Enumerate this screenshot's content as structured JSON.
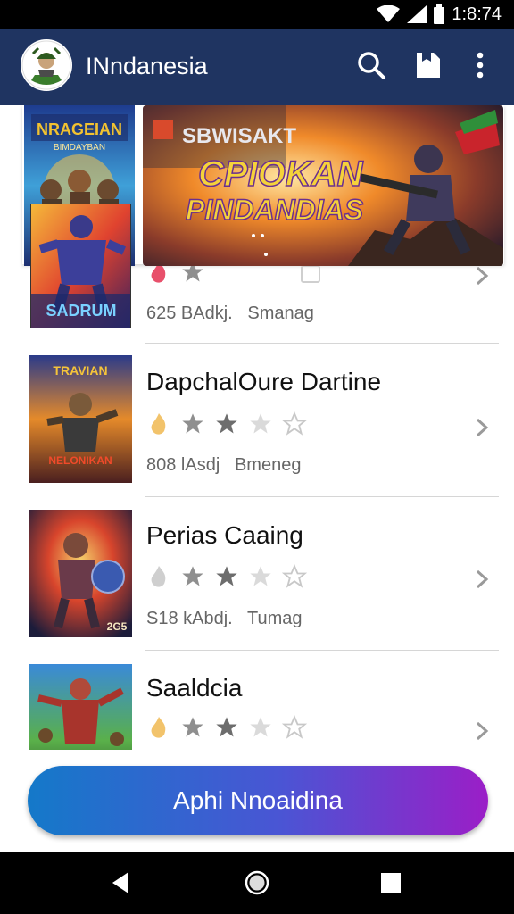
{
  "status": {
    "time": "1:8:74"
  },
  "app": {
    "title": "INndanesia",
    "logo_label": "",
    "actions": [
      "search-icon",
      "bookmark-icon",
      "more-vert-icon"
    ]
  },
  "featured": {
    "small_poster_title": "NRAGEIAN",
    "small_poster_subtitle": "BIMDAYBAN",
    "banner_line1": "SBWISAKT",
    "banner_line2": "CPIOKAN",
    "banner_line3": "PINDANDIAS",
    "inset_poster_title": "SADRUM"
  },
  "items": [
    {
      "title": "",
      "meta_left": "625 BAdkj.",
      "meta_right": "Smanag",
      "rating_icons": [
        "flame-icon",
        "star-icon",
        "star-icon",
        "star-icon",
        "star-icon"
      ]
    },
    {
      "title": "DapchalOure Dartine",
      "meta_left": "808 lAsdj",
      "meta_right": "Bmeneg",
      "poster_text": "TRAVIAN",
      "poster_sub": "NELONIKAN",
      "rating_icons": [
        "flame-icon",
        "star-icon",
        "star-icon",
        "star-icon",
        "star-icon"
      ]
    },
    {
      "title": "Perias Caaing",
      "meta_left": "S18 kAbdj.",
      "meta_right": "Tumag",
      "poster_text": "2G5",
      "rating_icons": [
        "flame-icon",
        "star-icon",
        "star-icon",
        "star-icon",
        "star-icon"
      ]
    },
    {
      "title": "Saaldcia",
      "meta_left": "",
      "meta_right": "",
      "rating_icons": [
        "flame-icon",
        "star-icon",
        "star-icon",
        "star-icon",
        "star-icon"
      ]
    }
  ],
  "cta": {
    "label": "Aphi Nnoaidina"
  },
  "colors": {
    "app_bar": "#1f3461",
    "cta_start": "#1479c9",
    "cta_end": "#9b1ec7"
  }
}
